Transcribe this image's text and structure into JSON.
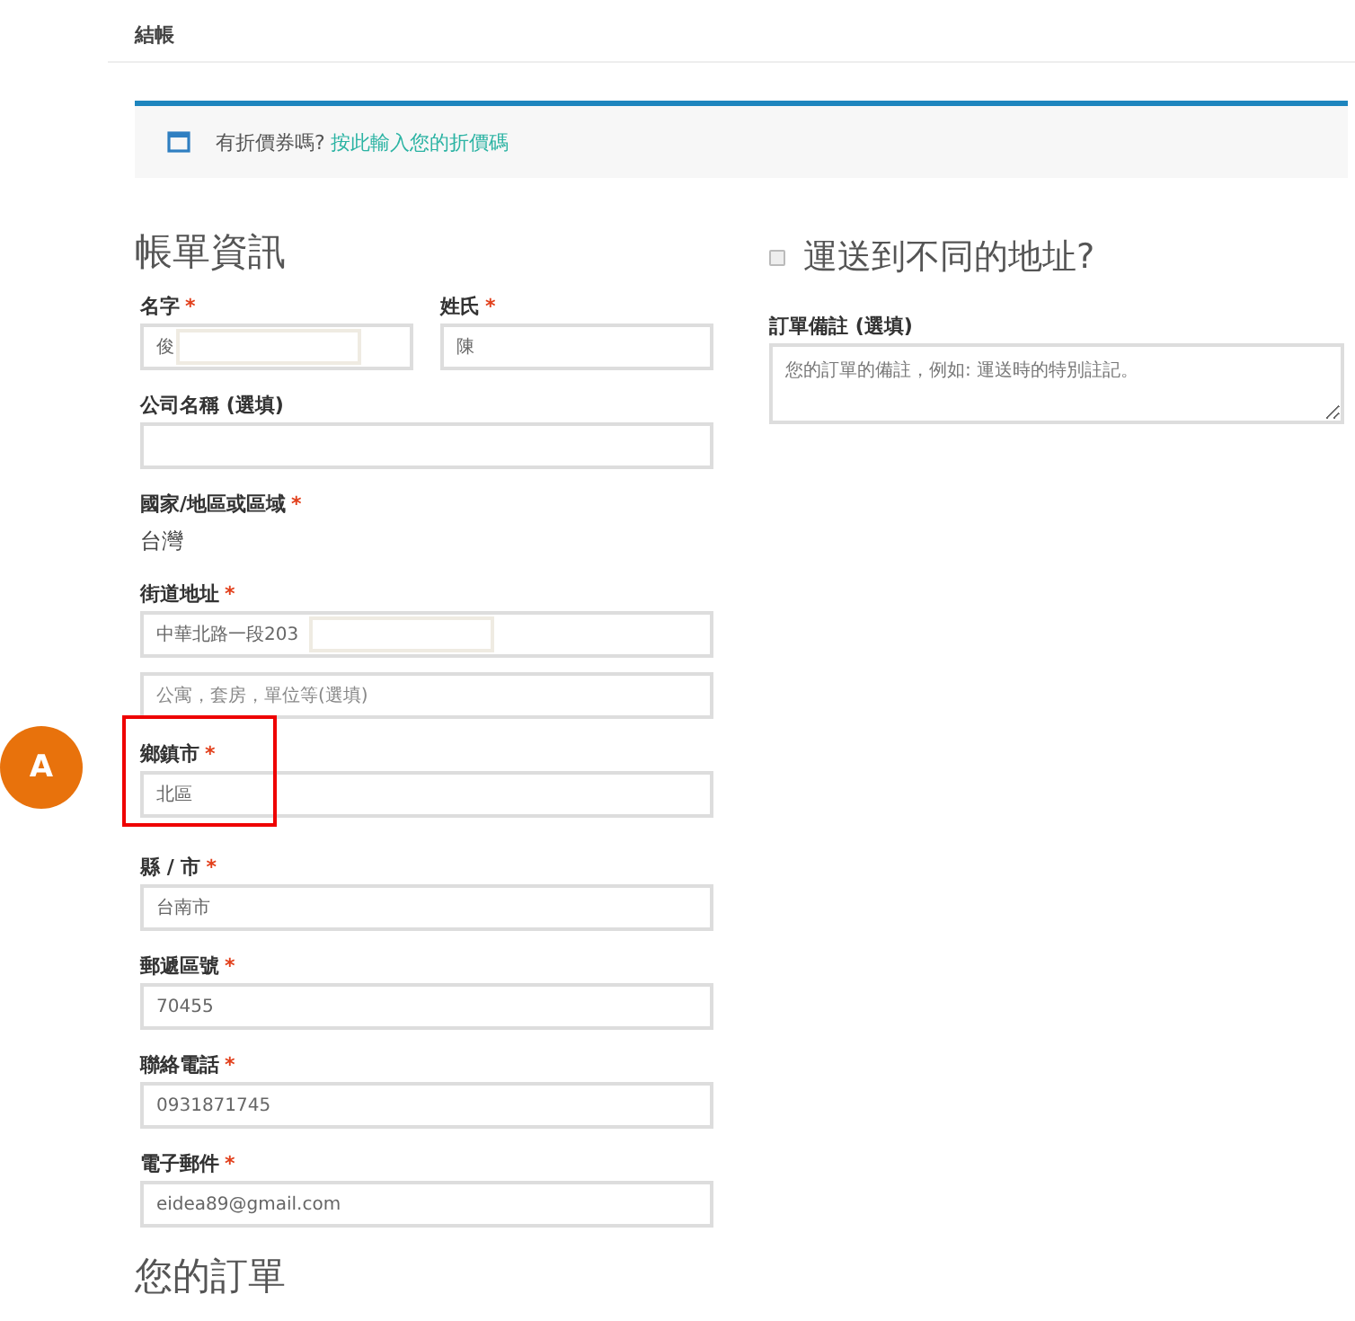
{
  "header": {
    "title": "結帳"
  },
  "coupon": {
    "text": "有折價券嗎?",
    "link": "按此輸入您的折價碼"
  },
  "billing": {
    "title": "帳單資訊",
    "rows": [
      [
        {
          "kind": "input",
          "label": "名字",
          "required_mark": "*",
          "inputs": [
            {
              "value": "俊",
              "redacted": true
            }
          ]
        },
        {
          "kind": "input",
          "label": "姓氏",
          "required_mark": "*",
          "inputs": [
            {
              "value": "陳"
            }
          ]
        }
      ],
      [
        {
          "kind": "empty_input",
          "label": "公司名稱 (選填)"
        }
      ],
      [
        {
          "kind": "static",
          "label": "國家/地區或區域",
          "required_mark": "*",
          "value": "台灣"
        }
      ],
      [
        {
          "kind": "input",
          "label": "街道地址",
          "required_mark": "*",
          "inputs": [
            {
              "value": "中華北路一段203",
              "redacted": true
            },
            {
              "placeholder": "公寓，套房，單位等(選填)"
            }
          ]
        }
      ],
      [
        {
          "kind": "input",
          "label": "鄉鎮市",
          "required_mark": "*",
          "highlighted": true,
          "inputs": [
            {
              "value": "北區"
            }
          ]
        }
      ],
      [
        {
          "kind": "input",
          "label": "縣 / 市",
          "required_mark": "*",
          "inputs": [
            {
              "value": "台南市"
            }
          ]
        }
      ],
      [
        {
          "kind": "input",
          "label": "郵遞區號",
          "required_mark": "*",
          "inputs": [
            {
              "value": "70455"
            }
          ]
        }
      ],
      [
        {
          "kind": "input",
          "label": "聯絡電話",
          "required_mark": "*",
          "inputs": [
            {
              "value": "0931871745"
            }
          ]
        }
      ],
      [
        {
          "kind": "input",
          "label": "電子郵件",
          "required_mark": "*",
          "inputs": [
            {
              "value": "eidea89@gmail.com"
            }
          ]
        }
      ]
    ]
  },
  "order_title": "您的訂單",
  "shipping": {
    "title": "運送到不同的地址?",
    "checked": false,
    "notes_label": "訂單備註 (選填)",
    "notes_placeholder": "您的訂單的備註，例如: 運送時的特別註記。"
  },
  "annotation": {
    "label": "A"
  }
}
